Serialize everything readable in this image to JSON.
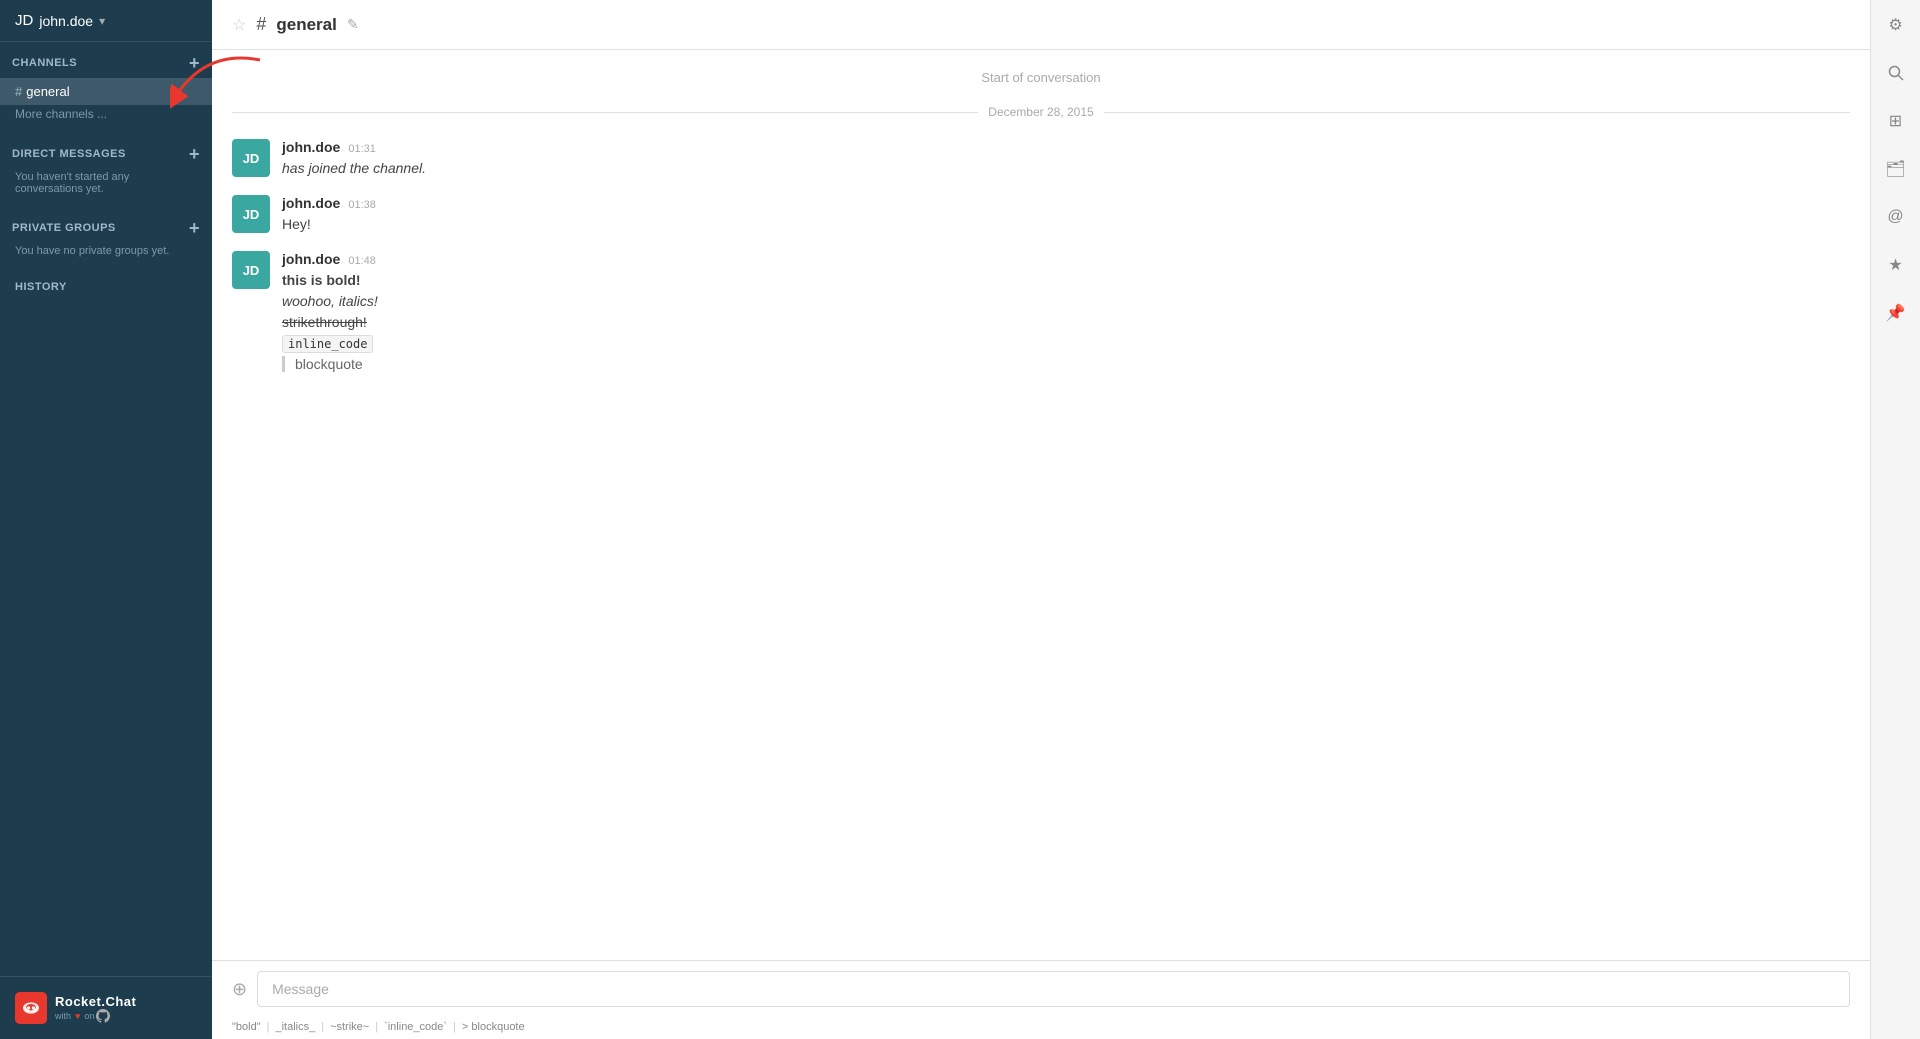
{
  "app": {
    "title": "Rocket.Chat",
    "subtitle": "with ♥ on"
  },
  "user": {
    "name": "john.doe",
    "initials": "JD"
  },
  "sidebar": {
    "channels_label": "CHANNELS",
    "direct_messages_label": "DIRECT MESSAGES",
    "private_groups_label": "PRIVATE GROUPS",
    "history_label": "HISTORY",
    "channels": [
      {
        "name": "general",
        "active": true
      }
    ],
    "more_channels": "More channels ...",
    "no_direct_messages": "You haven't started any conversations yet.",
    "no_private_groups": "You have no private groups yet."
  },
  "header": {
    "channel_name": "general",
    "hash": "#"
  },
  "chat": {
    "start_label": "Start of conversation",
    "date_divider": "December 28, 2015",
    "messages": [
      {
        "author": "john.doe",
        "time": "01:31",
        "text_italic": "has joined the channel.",
        "type": "join"
      },
      {
        "author": "john.doe",
        "time": "01:38",
        "text": "Hey!",
        "type": "normal"
      },
      {
        "author": "john.doe",
        "time": "01:48",
        "text_bold": "this is bold!",
        "text_italic": "woohoo, italics!",
        "text_strike": "strikethrough!",
        "text_code": "inline_code",
        "text_blockquote": "blockquote",
        "type": "formatted"
      }
    ]
  },
  "input": {
    "placeholder": "Message",
    "upload_label": "Upload",
    "format_hints": [
      {
        "label": "\"bold\""
      },
      {
        "label": "_italics_"
      },
      {
        "label": "~strike~"
      },
      {
        "label": "`inline_code`"
      },
      {
        "label": "> blockquote"
      }
    ]
  },
  "right_icons": [
    {
      "name": "settings-icon",
      "symbol": "⚙"
    },
    {
      "name": "search-icon",
      "symbol": "🔍"
    },
    {
      "name": "at-icon",
      "symbol": "✦"
    },
    {
      "name": "folder-icon",
      "symbol": "🗂"
    },
    {
      "name": "mention-icon",
      "symbol": "@"
    },
    {
      "name": "star-icon",
      "symbol": "★"
    },
    {
      "name": "pin-icon",
      "symbol": "📌"
    }
  ]
}
